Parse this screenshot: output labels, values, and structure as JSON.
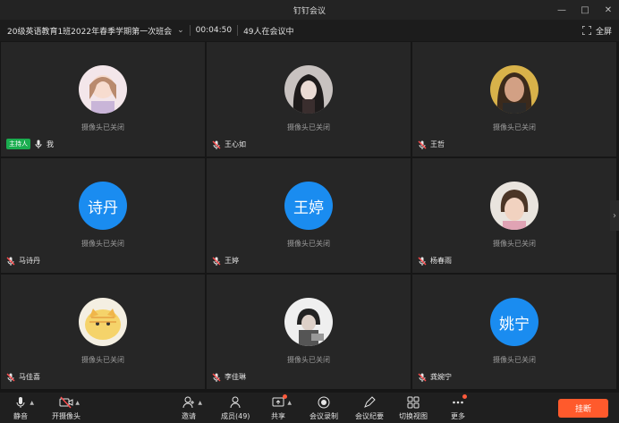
{
  "window": {
    "title": "钉钉会议"
  },
  "meeting": {
    "name": "20级英语教育1班2022年春季学期第一次班会",
    "duration": "00:04:50",
    "participants_text": "49人在会议中",
    "fullscreen_label": "全屏"
  },
  "camera_off_text": "摄像头已关闭",
  "host_badge": "主持人",
  "tiles": [
    {
      "name": "我",
      "avatar_type": "image"
    },
    {
      "name": "王心如",
      "avatar_type": "image"
    },
    {
      "name": "王哲",
      "avatar_type": "image"
    },
    {
      "name": "马诗丹",
      "avatar_type": "text",
      "avatar_text": "诗丹"
    },
    {
      "name": "王婷",
      "avatar_type": "text",
      "avatar_text": "王婷"
    },
    {
      "name": "杨春雨",
      "avatar_type": "image"
    },
    {
      "name": "马佳喜",
      "avatar_type": "image"
    },
    {
      "name": "李佳琳",
      "avatar_type": "image"
    },
    {
      "name": "龚婉宁",
      "avatar_type": "text",
      "avatar_text": "姚宁"
    }
  ],
  "toolbar": {
    "mute": "静音",
    "camera": "开摄像头",
    "invite": "邀请",
    "members": "成员(49)",
    "share": "共享",
    "record": "会议录制",
    "minutes": "会议纪要",
    "switch_view": "切换视图",
    "more": "更多",
    "hangup": "挂断"
  },
  "colors": {
    "accent": "#1a8cf0",
    "hangup": "#ff5a2c",
    "host": "#1aad4f",
    "mic_off": "#ff4d4f"
  }
}
